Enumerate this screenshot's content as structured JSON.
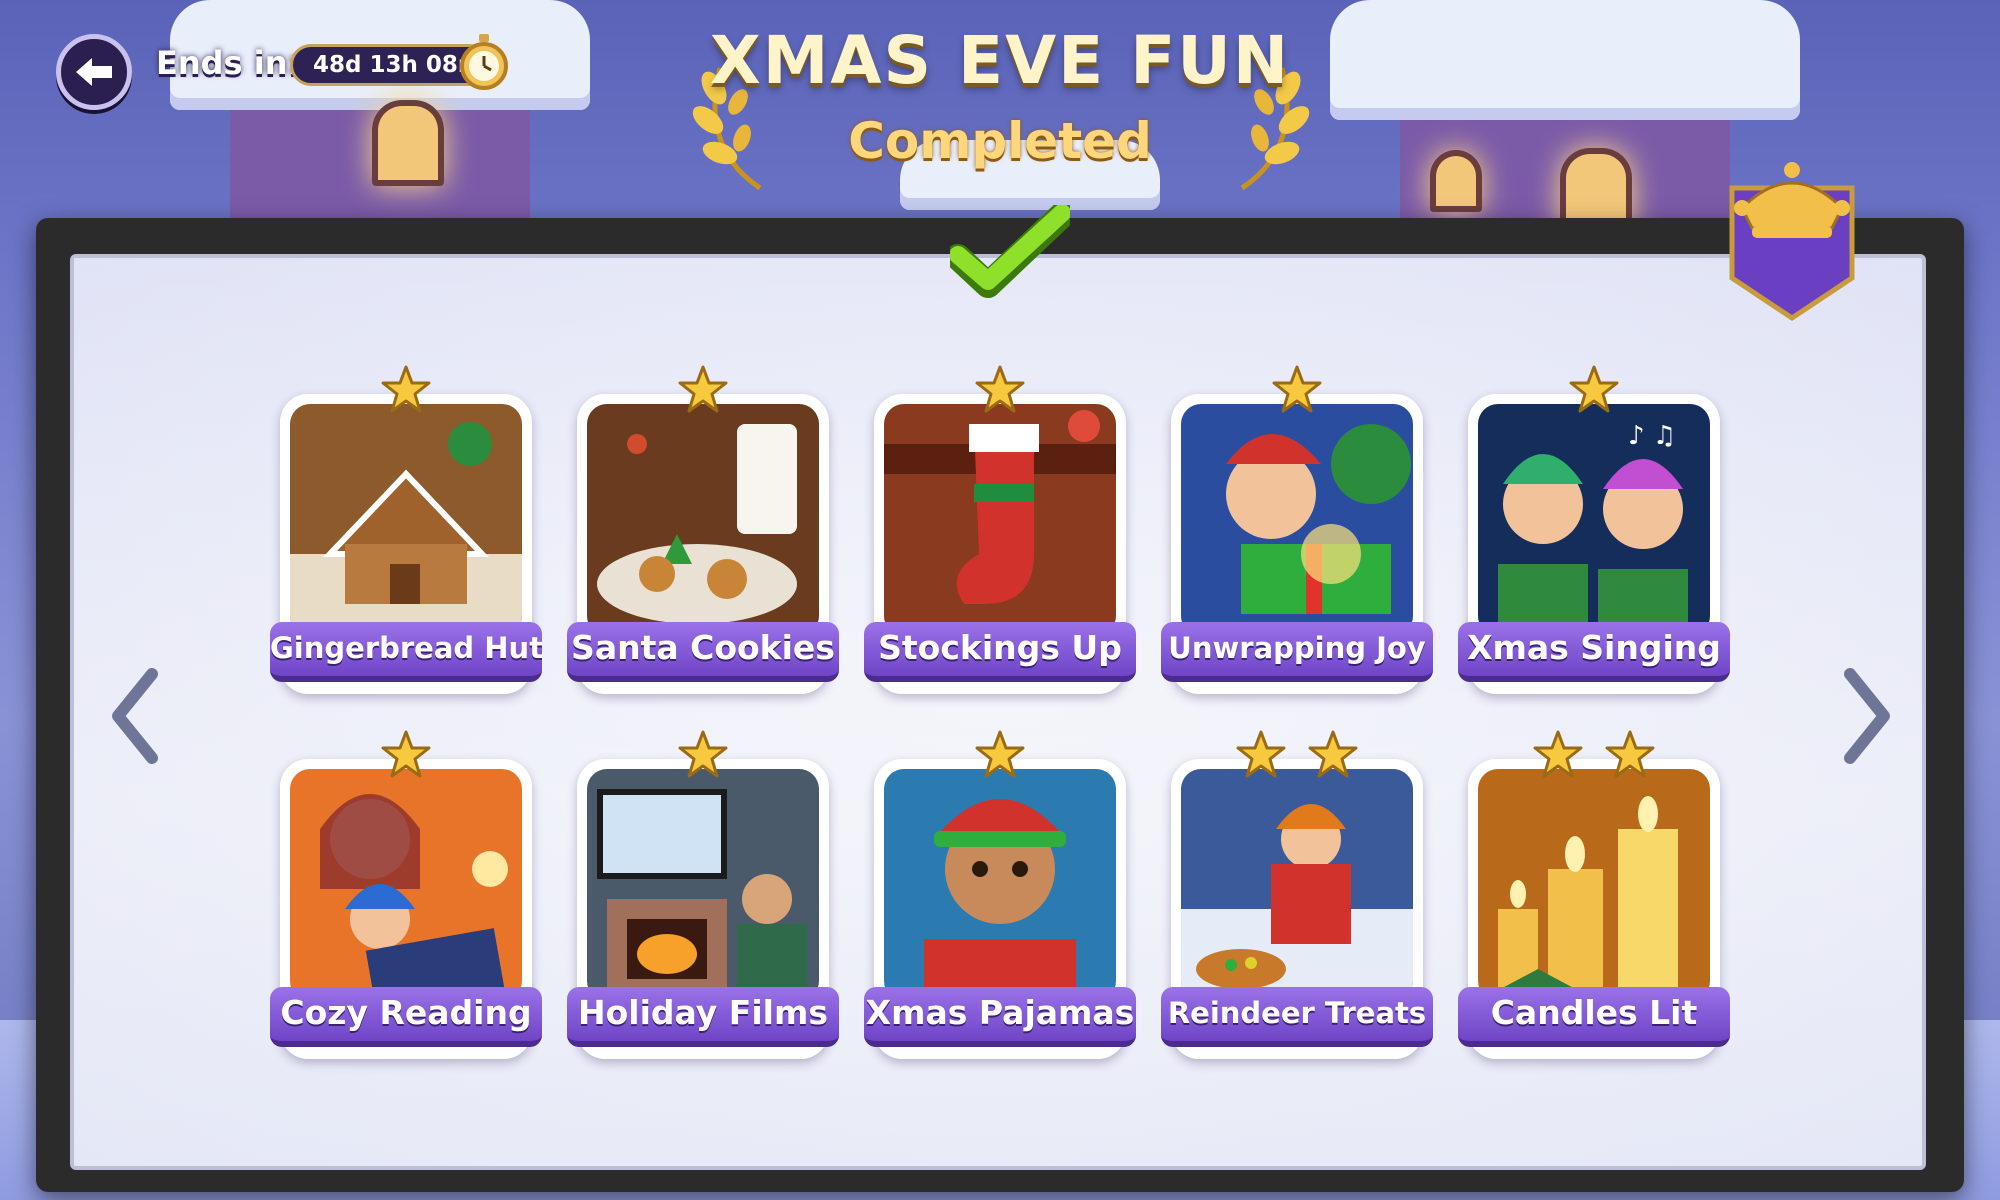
{
  "header": {
    "ends_label": "Ends in:",
    "timer": "48d 13h 08m",
    "title": "XMAS EVE FUN",
    "subtitle": "Completed"
  },
  "icons": {
    "back": "back-arrow-icon",
    "clock": "stopwatch-icon",
    "check": "checkmark-icon",
    "banner": "jester-hat-banner-icon",
    "star": "star-icon"
  },
  "colors": {
    "accent_purple": "#7a52d6",
    "gold": "#ffd67a",
    "check_green": "#7bd31e"
  },
  "cards": [
    {
      "label": "Gingerbread Hut",
      "stars": 1,
      "scene": "gingerbread"
    },
    {
      "label": "Santa Cookies",
      "stars": 1,
      "scene": "cookies"
    },
    {
      "label": "Stockings Up",
      "stars": 1,
      "scene": "stocking"
    },
    {
      "label": "Unwrapping Joy",
      "stars": 1,
      "scene": "gift"
    },
    {
      "label": "Xmas Singing",
      "stars": 1,
      "scene": "singing"
    },
    {
      "label": "Cozy Reading",
      "stars": 1,
      "scene": "reading"
    },
    {
      "label": "Holiday Films",
      "stars": 1,
      "scene": "films"
    },
    {
      "label": "Xmas Pajamas",
      "stars": 1,
      "scene": "pajamas"
    },
    {
      "label": "Reindeer Treats",
      "stars": 2,
      "scene": "treats"
    },
    {
      "label": "Candles Lit",
      "stars": 2,
      "scene": "candles"
    }
  ]
}
